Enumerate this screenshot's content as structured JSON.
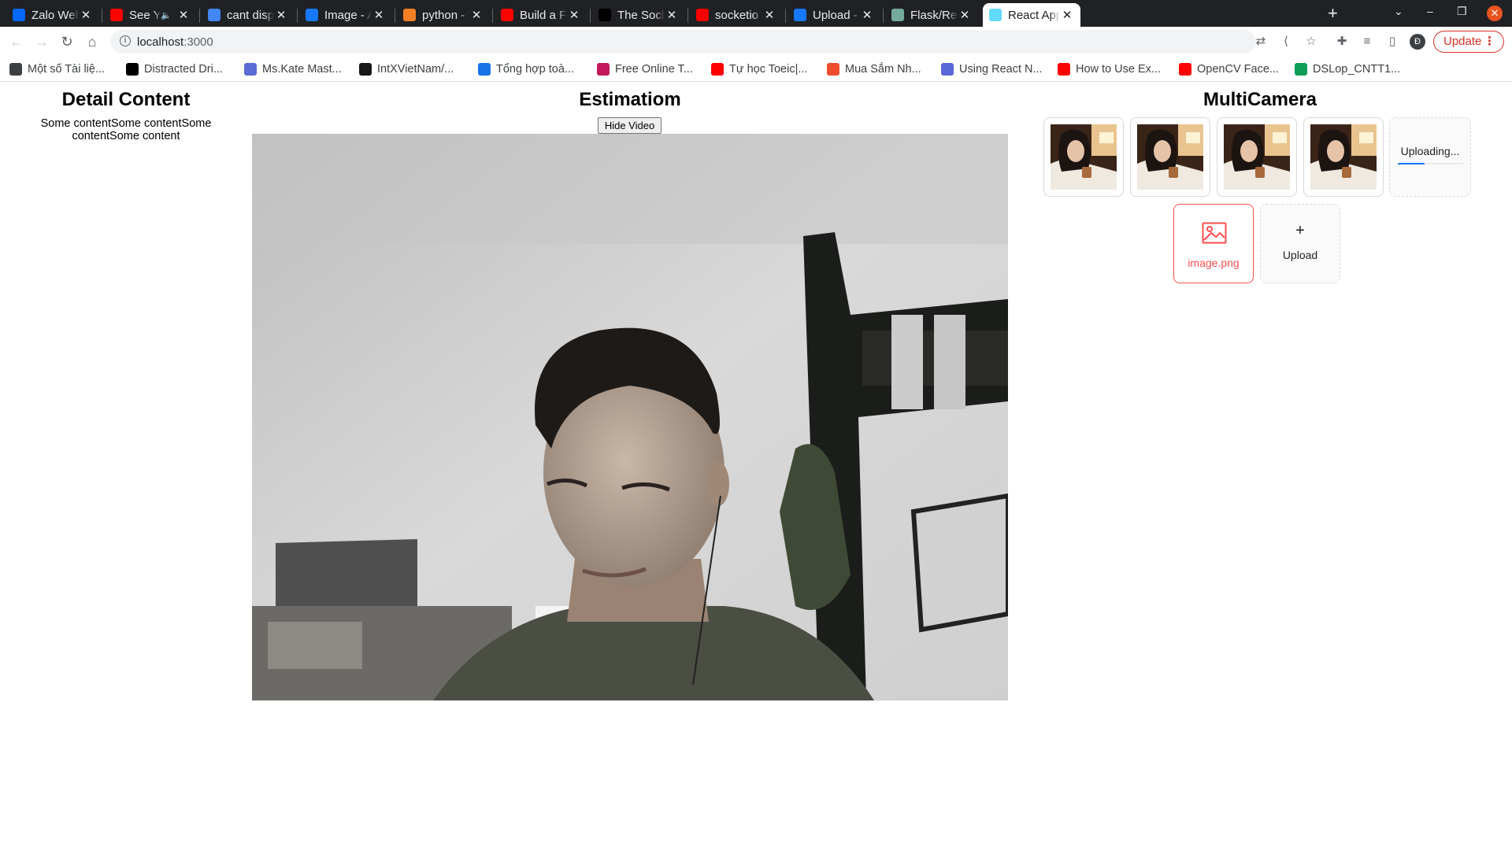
{
  "browser": {
    "tabs": [
      {
        "label": "Zalo Web",
        "icon": "zalo-icon",
        "color": "#0068ff"
      },
      {
        "label": "See You Again",
        "icon": "youtube-icon",
        "color": "#ff0000",
        "audio": "🔈"
      },
      {
        "label": "cant display image",
        "icon": "google-icon",
        "color": "#4285f4"
      },
      {
        "label": "Image - Ant Design",
        "icon": "antdesign-icon",
        "color": "#1677ff"
      },
      {
        "label": "python - \"TypeError",
        "icon": "stackoverflow-icon",
        "color": "#f48024"
      },
      {
        "label": "Build a Flask",
        "icon": "youtube-icon",
        "color": "#ff0000"
      },
      {
        "label": "The Socket io",
        "icon": "socketio-icon",
        "color": "#010101"
      },
      {
        "label": "socketio with",
        "icon": "youtube-icon",
        "color": "#ff0000"
      },
      {
        "label": "Upload - Ant Design",
        "icon": "antdesign-icon",
        "color": "#1677ff"
      },
      {
        "label": "Flask/React",
        "icon": "chatgpt-icon",
        "color": "#74aa9c"
      },
      {
        "label": "React App",
        "icon": "react-icon",
        "color": "#61dafb",
        "active": true
      }
    ],
    "new_tab": "+",
    "chevron": "⌄",
    "minimize": "–",
    "restore": "❐",
    "close": "✕",
    "url_host": "localhost",
    "url_port": ":3000",
    "profile_initial": "Đ",
    "update_label": "Update",
    "update_dots": "⋮"
  },
  "bookmarks": [
    {
      "label": "Một số Tài liệ...",
      "icon": "globe-icon",
      "color": "#3c4043"
    },
    {
      "label": "Distracted Dri...",
      "icon": "notion-icon",
      "color": "#000000"
    },
    {
      "label": "Ms.Kate Mast...",
      "icon": "kate-icon",
      "color": "#5b6bd5"
    },
    {
      "label": "IntXVietNam/...",
      "icon": "github-icon",
      "color": "#181717"
    },
    {
      "label": "Tổng hợp toà...",
      "icon": "tonghop-icon",
      "color": "#1a73e8"
    },
    {
      "label": "Free Online T...",
      "icon": "freeonline-icon",
      "color": "#c2185b"
    },
    {
      "label": "Tự học Toeic|...",
      "icon": "youtube-icon",
      "color": "#ff0000"
    },
    {
      "label": "Mua Sắm Nh...",
      "icon": "cart-icon",
      "color": "#ee4d2d"
    },
    {
      "label": "Using React N...",
      "icon": "layers-icon",
      "color": "#5a67d8"
    },
    {
      "label": "How to Use Ex...",
      "icon": "youtube-icon",
      "color": "#ff0000"
    },
    {
      "label": "OpenCV Face...",
      "icon": "youtube-icon",
      "color": "#ff0000"
    },
    {
      "label": "DSLop_CNTT1...",
      "icon": "sheets-icon",
      "color": "#0f9d58"
    }
  ],
  "page": {
    "detail": {
      "title": "Detail Content",
      "text": "Some contentSome contentSome contentSome content"
    },
    "estimation": {
      "title": "Estimatiom",
      "hide_button": "Hide Video"
    },
    "multicamera": {
      "title": "MultiCamera",
      "thumbnails": 4,
      "uploading_text": "Uploading...",
      "upload_progress": 0.4,
      "error_file": "image.png",
      "upload_plus": "+",
      "upload_label": "Upload"
    }
  }
}
